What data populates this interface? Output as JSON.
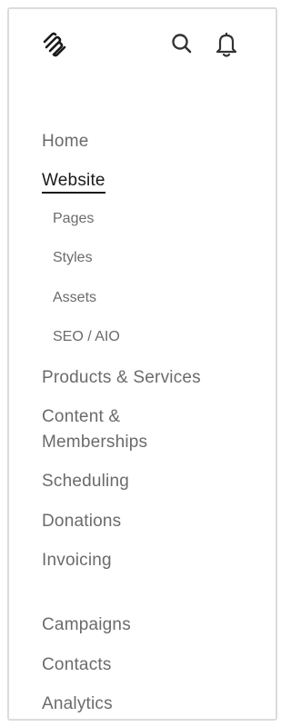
{
  "header": {
    "logo_icon": "squarespace-logo-icon",
    "search_icon": "search-icon",
    "notifications_icon": "bell-icon"
  },
  "nav": {
    "home": "Home",
    "website": "Website",
    "website_sub": {
      "pages": "Pages",
      "styles": "Styles",
      "assets": "Assets",
      "seo": "SEO / AIO"
    },
    "products": "Products & Services",
    "content": "Content & Memberships",
    "scheduling": "Scheduling",
    "donations": "Donations",
    "invoicing": "Invoicing",
    "campaigns": "Campaigns",
    "contacts": "Contacts",
    "analytics": "Analytics"
  },
  "colors": {
    "text_muted": "#6b6b6b",
    "text_active": "#1a1a1a",
    "border": "#dcdcdc"
  }
}
